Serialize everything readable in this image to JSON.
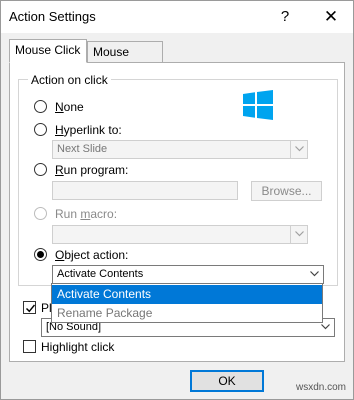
{
  "window": {
    "title": "Action Settings",
    "help_label": "?",
    "close_label": "✕"
  },
  "tabs": [
    {
      "label": "Mouse Click",
      "active": true
    },
    {
      "label": "Mouse Over",
      "active": false
    }
  ],
  "action_group": {
    "legend": "Action on click",
    "options": [
      {
        "label_pre": "",
        "label_u": "N",
        "label_post": "one",
        "checked": false,
        "enabled": true
      },
      {
        "label_pre": "",
        "label_u": "H",
        "label_post": "yperlink to:",
        "checked": false,
        "enabled": true
      },
      {
        "label_pre": "",
        "label_u": "R",
        "label_post": "un program:",
        "checked": false,
        "enabled": true
      },
      {
        "label_pre": "Run ",
        "label_u": "m",
        "label_post": "acro:",
        "checked": false,
        "enabled": false
      },
      {
        "label_pre": "",
        "label_u": "O",
        "label_post": "bject action:",
        "checked": true,
        "enabled": true
      }
    ],
    "hyperlink_value": "Next Slide",
    "program_value": "",
    "browse_label": "Browse...",
    "macro_value": "",
    "object_action_value": "Activate Contents"
  },
  "object_action_dropdown": {
    "items": [
      "Activate Contents",
      "Rename Package"
    ],
    "selected_index": 0
  },
  "play_sound": {
    "label_visible": "Pla",
    "checked": true,
    "value": "[No Sound]"
  },
  "highlight_click": {
    "label": "Highlight click",
    "checked": false
  },
  "footer": {
    "ok_label": "OK"
  },
  "watermark": "wsxdn.com",
  "colors": {
    "selection_blue": "#0078d7",
    "logo_blue": "#00a4ef"
  },
  "icons": {
    "logo": "windows-logo-icon"
  }
}
